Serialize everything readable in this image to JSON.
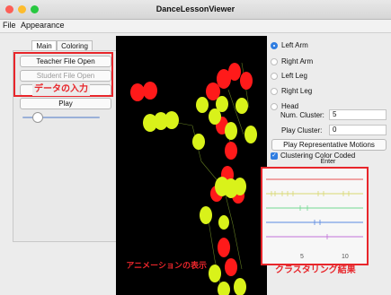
{
  "window": {
    "title": "DanceLessonViewer"
  },
  "menubar": {
    "items": [
      "File",
      "Appearance"
    ]
  },
  "tabs": [
    {
      "label": "Main",
      "active": true
    },
    {
      "label": "Coloring",
      "active": false
    }
  ],
  "left": {
    "teacher_button": "Teacher File Open",
    "student_button": "Student File Open",
    "play_button": "Play",
    "slider_value": 0.2
  },
  "body_parts": [
    {
      "label": "Left Arm",
      "selected": true
    },
    {
      "label": "Right Arm",
      "selected": false
    },
    {
      "label": "Left Leg",
      "selected": false
    },
    {
      "label": "Right Leg",
      "selected": false
    },
    {
      "label": "Head",
      "selected": false
    }
  ],
  "controls": {
    "num_cluster_label": "Num. Cluster:",
    "num_cluster_value": "5",
    "play_cluster_label": "Play Cluster:",
    "play_cluster_value": "0",
    "play_representative_button": "Play Representative Motions",
    "clustering_color_label": "Clustering Color Coded",
    "clustering_color_checked": true,
    "enter_button": "Enter"
  },
  "cluster_chart": {
    "x_ticks": [
      "5",
      "10"
    ],
    "rows": [
      {
        "color": "#e85050"
      },
      {
        "color": "#d8d870"
      },
      {
        "color": "#70d890"
      },
      {
        "color": "#5a88e0"
      },
      {
        "color": "#c070d8"
      }
    ]
  },
  "annotations": {
    "data_input": "データの入力",
    "animation": "アニメーションの表示",
    "clustering": "クラスタリング結果"
  },
  "colors": {
    "accent": "#2f7de1",
    "annotation_red": "#e8262b",
    "marker_red": "#ff1a1a",
    "marker_yellow": "#d9f21a"
  }
}
